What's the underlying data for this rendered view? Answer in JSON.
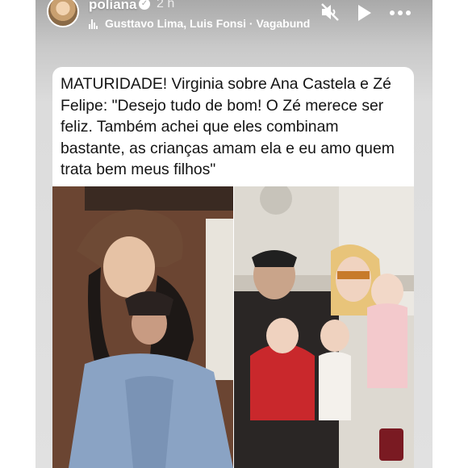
{
  "header": {
    "username": "poliana",
    "verified_icon": "verified-badge-icon",
    "time": "2 h",
    "music": "Gusttavo Lima, Luis Fonsi · Vagabund",
    "icons": [
      "music-icon",
      "mute-icon",
      "play-icon",
      "more-icon"
    ]
  },
  "post": {
    "caption": "MATURIDADE! Virginia sobre Ana Castela e Zé Felipe: \"Desejo tudo de bom! O Zé merece ser feliz. Também achei que eles combinam bastante, as crianças amam ela e eu amo quem trata bem meus filhos\""
  },
  "colors": {
    "story_background": "#dcdcdc",
    "caption_background": "#ffffff",
    "text": "#141414"
  }
}
